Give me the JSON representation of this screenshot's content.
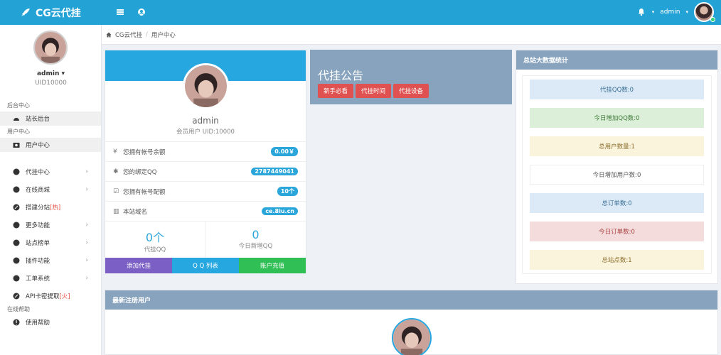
{
  "header": {
    "brand": "CG云代挂",
    "user": "admin",
    "colors": {
      "bar": "#23a2d6"
    }
  },
  "sidebar": {
    "name": "admin",
    "uid": "UID10000",
    "sections": {
      "admin_center": "后台中心",
      "user_center": "用户中心",
      "help": "在线帮助"
    },
    "items": [
      {
        "label": "站长后台",
        "icon": "dashboard-icon"
      },
      {
        "label": "用户中心",
        "icon": "camera-icon"
      },
      {
        "label": "代挂中心",
        "icon": "globe-icon"
      },
      {
        "label": "在线商城",
        "icon": "globe-icon"
      },
      {
        "label": "搭建分站",
        "hot": "[热]",
        "icon": "rocket-icon"
      },
      {
        "label": "更多功能",
        "icon": "globe-icon"
      },
      {
        "label": "站点榜单",
        "icon": "globe-icon"
      },
      {
        "label": "插件功能",
        "icon": "globe-icon"
      },
      {
        "label": "工单系统",
        "icon": "globe-icon"
      },
      {
        "label": "API卡密提取",
        "hot": "[火]",
        "icon": "rocket-icon"
      },
      {
        "label": "使用帮助",
        "icon": "info-icon"
      }
    ]
  },
  "breadcrumb": {
    "home": "CG云代挂",
    "current": "用户中心"
  },
  "profile": {
    "name": "admin",
    "role": "会员用户 UID:10000",
    "rows": [
      {
        "icon": "yen-icon",
        "glyph": "¥",
        "label": "您拥有帐号余额",
        "value": "0.00￥"
      },
      {
        "icon": "gear-icon",
        "glyph": "✱",
        "label": "您的绑定QQ",
        "value": "2787449041"
      },
      {
        "icon": "check-icon",
        "glyph": "☑",
        "label": "您拥有帐号配额",
        "value": "10个"
      },
      {
        "icon": "bar-chart-icon",
        "glyph": "▥",
        "label": "本站域名",
        "value": "ce.8iu.cn"
      }
    ],
    "stats": [
      {
        "value": "0个",
        "label": "代挂QQ"
      },
      {
        "value": "0",
        "label": "今日新增QQ"
      }
    ],
    "buttons": [
      {
        "label": "添加代挂",
        "color": "#7b5fc4"
      },
      {
        "label": "Q Q 列表",
        "color": "#26a7e0"
      },
      {
        "label": "账户充值",
        "color": "#2fbf55"
      }
    ]
  },
  "announcement": {
    "title": "代挂公告",
    "buttons": [
      "新手必看",
      "代挂时间",
      "代挂设备"
    ]
  },
  "site_stats": {
    "title": "总站大数据统计",
    "items": [
      {
        "label": "代挂QQ数:0",
        "bg": "#dbeaf6",
        "fg": "#3a6d96"
      },
      {
        "label": "今日增加QQ数:0",
        "bg": "#dcefd8",
        "fg": "#3f7a3a"
      },
      {
        "label": "总用户数量:1",
        "bg": "#fbf4dc",
        "fg": "#8a6d2c"
      },
      {
        "label": "今日增加用户数:0",
        "bg": "#ffffff",
        "fg": "#555555"
      },
      {
        "label": "总订单数:0",
        "bg": "#dbeaf6",
        "fg": "#3a6d96"
      },
      {
        "label": "今日订单数:0",
        "bg": "#f4dcdc",
        "fg": "#a94442"
      },
      {
        "label": "总站点数:1",
        "bg": "#fbf4dc",
        "fg": "#8a6d2c"
      }
    ]
  },
  "new_users": {
    "title": "最新注册用户"
  }
}
